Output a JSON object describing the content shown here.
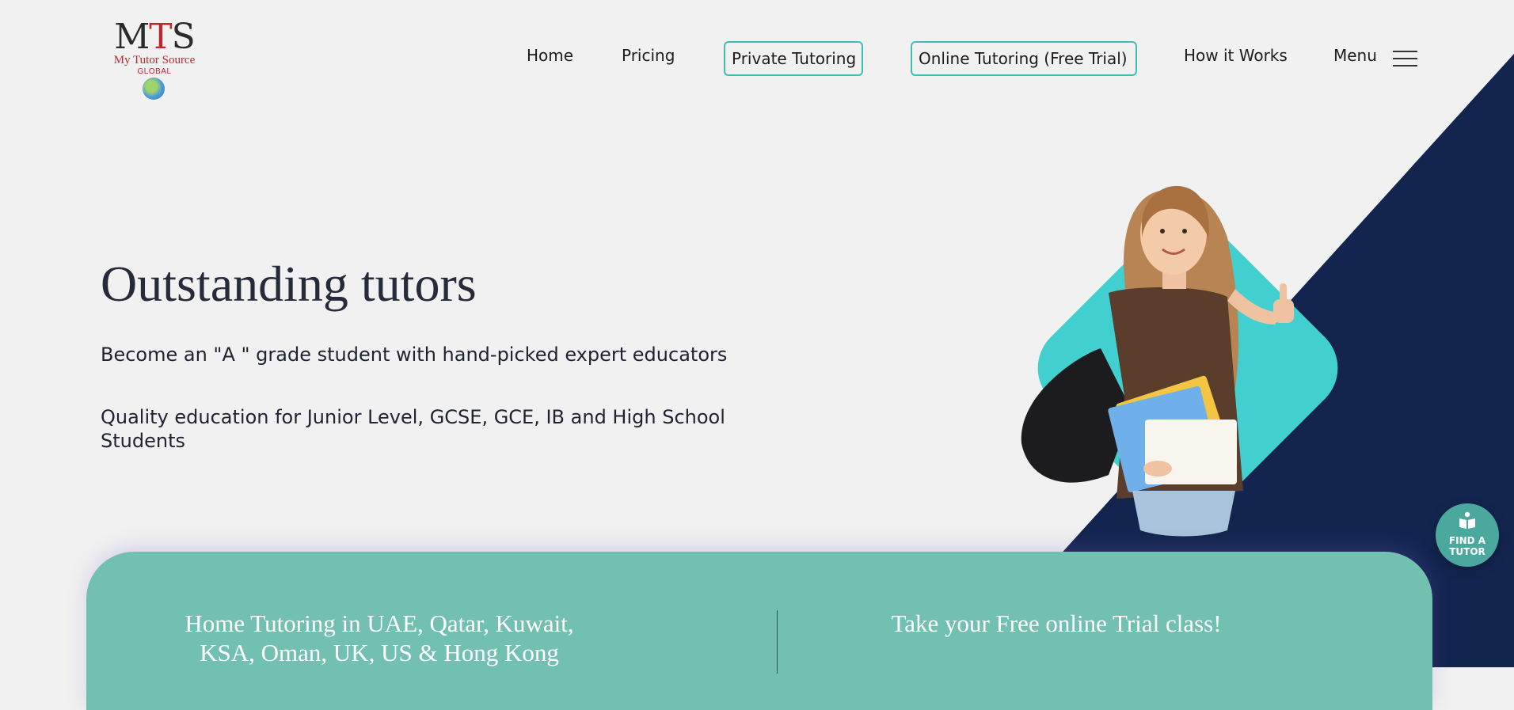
{
  "colors": {
    "background": "#f1f1f1",
    "navy": "#13254f",
    "teal_diamond": "#42cfd0",
    "accent_border": "#3fbfb3",
    "band": "#72c0b0",
    "logo_red": "#c0262d"
  },
  "logo": {
    "mark_left": "M",
    "mark_mid": "T",
    "mark_right": "S",
    "name": "My Tutor Source",
    "sub": "GLOBAL",
    "icon": "globe-icon"
  },
  "nav": {
    "home": "Home",
    "pricing": "Pricing",
    "private_tutoring": "Private Tutoring",
    "online_tutoring": "Online Tutoring (Free Trial)",
    "how_it_works": "How it Works",
    "menu": "Menu",
    "menu_icon": "hamburger-icon"
  },
  "hero": {
    "title": "Outstanding tutors",
    "line1": "Become an \"A \" grade student with hand-picked expert educators",
    "line2": "Quality education for Junior Level, GCSE, GCE, IB and High School Students",
    "image_icon": "student-photo"
  },
  "find_tutor": {
    "label_line1": "FIND A",
    "label_line2": "TUTOR",
    "icon": "open-book-icon"
  },
  "band": {
    "left_text": "Home Tutoring in UAE, Qatar, Kuwait, KSA, Oman, UK, US & Hong Kong",
    "right_text": "Take your Free online Trial class!"
  }
}
